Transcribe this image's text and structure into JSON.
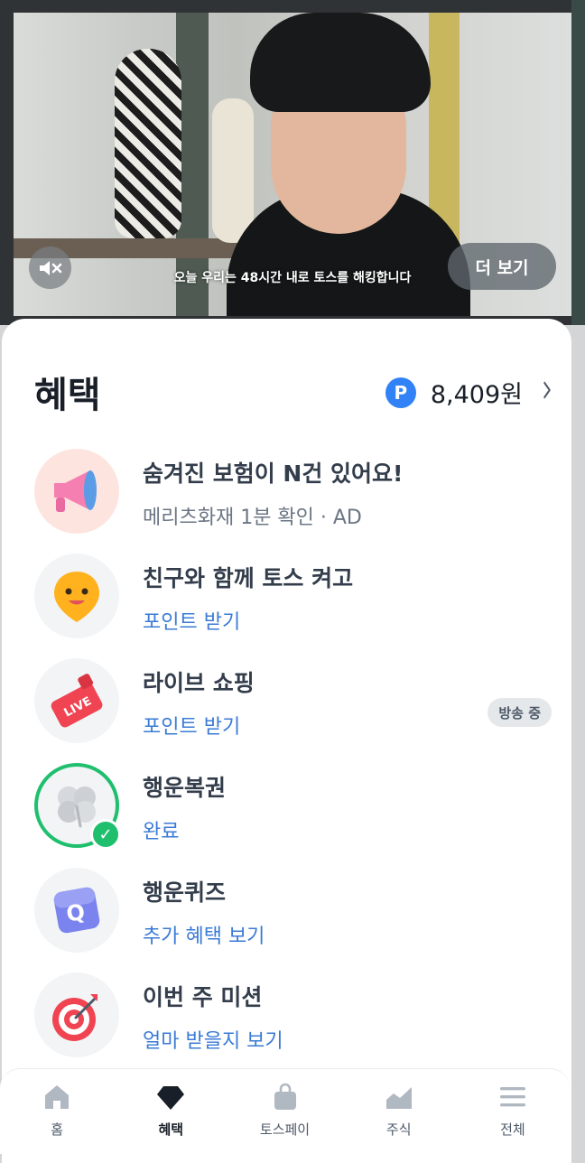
{
  "video_ad": {
    "mute_icon": "speaker-muted-icon",
    "caption": "오늘 우리는 48시간 내로 토스를 해킹합니다",
    "more_button": "더 보기"
  },
  "benefits": {
    "title": "혜택",
    "points_badge": "P",
    "points_amount": "8,409원",
    "items": [
      {
        "icon": "megaphone-icon",
        "title": "숨겨진 보험이 N건 있어요!",
        "subtitle": "메리츠화재 1분 확인 · AD",
        "subtitle_color": "gray"
      },
      {
        "icon": "smile-pin-icon",
        "title": "친구와 함께 토스 켜고",
        "subtitle": "포인트 받기",
        "subtitle_color": "blue"
      },
      {
        "icon": "live-tv-icon",
        "title": "라이브 쇼핑",
        "subtitle": "포인트 받기",
        "subtitle_color": "blue",
        "badge": "방송 중"
      },
      {
        "icon": "clover-icon",
        "title": "행운복권",
        "subtitle": "완료",
        "subtitle_color": "blue",
        "completed": true
      },
      {
        "icon": "quiz-q-icon",
        "title": "행운퀴즈",
        "subtitle": "추가 혜택 보기",
        "subtitle_color": "blue"
      },
      {
        "icon": "target-icon",
        "title": "이번 주 미션",
        "subtitle": "얼마 받을지 보기",
        "subtitle_color": "blue"
      }
    ]
  },
  "nav": {
    "tabs": [
      {
        "icon": "home-icon",
        "label": "홈"
      },
      {
        "icon": "diamond-icon",
        "label": "혜택",
        "active": true
      },
      {
        "icon": "shopping-bag-icon",
        "label": "토스페이"
      },
      {
        "icon": "chart-icon",
        "label": "주식"
      },
      {
        "icon": "menu-icon",
        "label": "전체"
      }
    ]
  },
  "colors": {
    "accent_blue": "#3182f6",
    "link_blue": "#3a7bd5",
    "complete_green": "#1fbf6e",
    "title_text": "#191f28"
  }
}
